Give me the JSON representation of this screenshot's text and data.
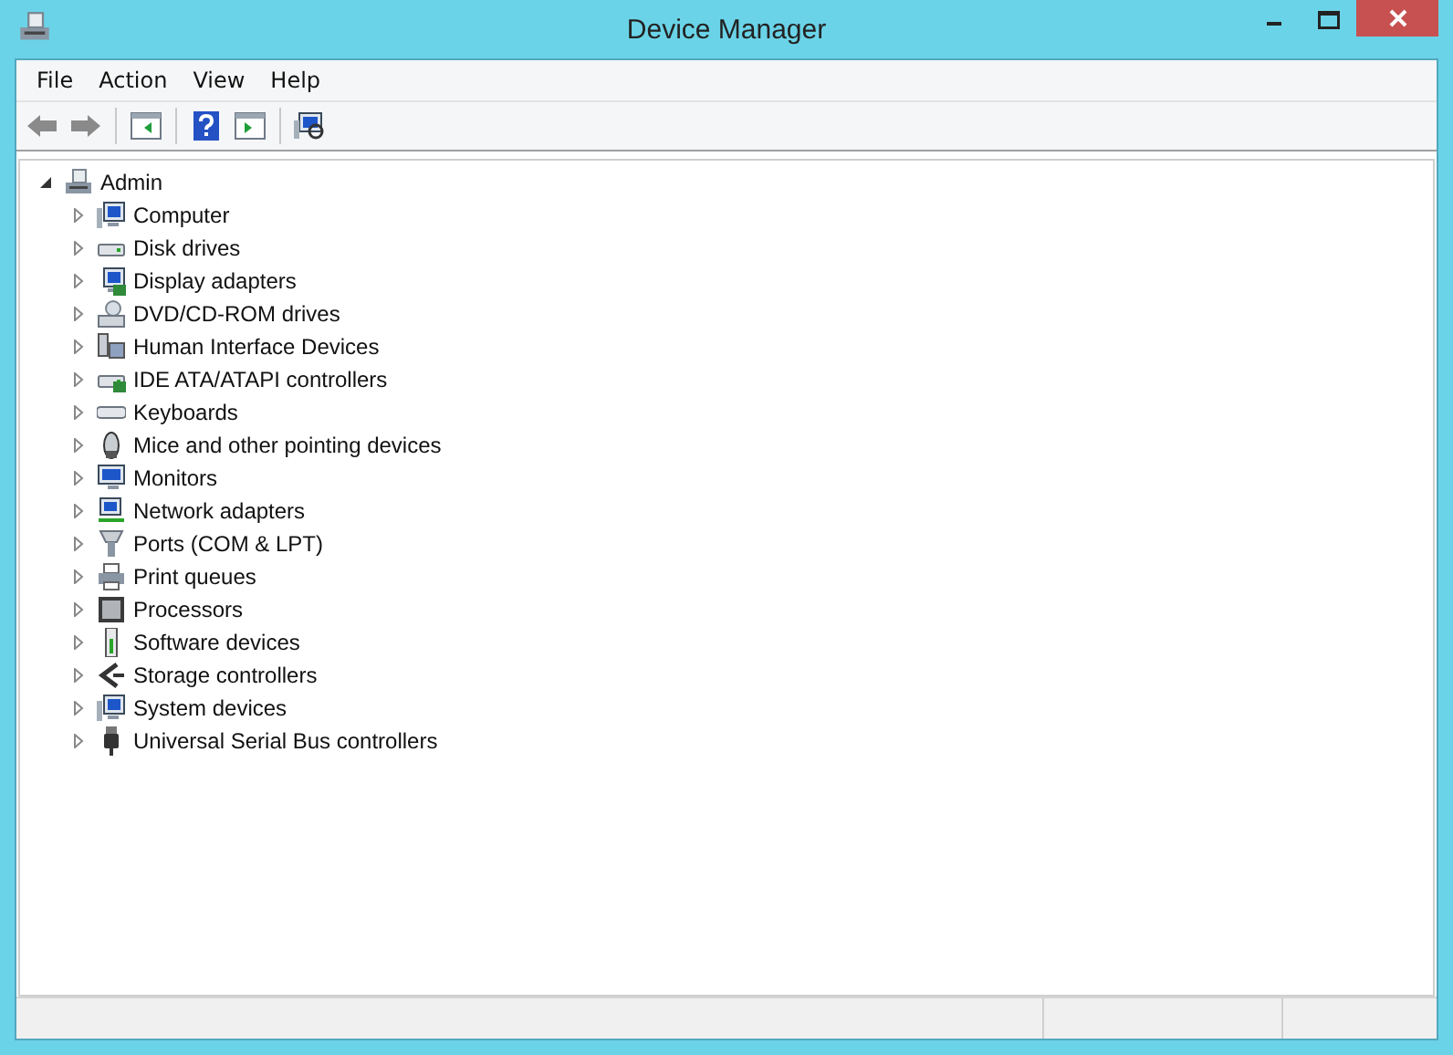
{
  "window": {
    "title": "Device Manager"
  },
  "menu": [
    "File",
    "Action",
    "View",
    "Help"
  ],
  "toolbar": [
    {
      "kind": "back",
      "disabled": true
    },
    {
      "kind": "forward",
      "disabled": true
    },
    {
      "kind": "sep"
    },
    {
      "kind": "hidepane",
      "disabled": false
    },
    {
      "kind": "sep"
    },
    {
      "kind": "help",
      "disabled": false
    },
    {
      "kind": "showpane",
      "disabled": false
    },
    {
      "kind": "sep"
    },
    {
      "kind": "scan",
      "disabled": false
    }
  ],
  "tree": {
    "label": "Admin",
    "kind": "host",
    "expanded": true,
    "children": [
      {
        "label": "Computer",
        "kind": "computer",
        "expanded": false
      },
      {
        "label": "Disk drives",
        "kind": "disk",
        "expanded": false
      },
      {
        "label": "Display adapters",
        "kind": "display",
        "expanded": false
      },
      {
        "label": "DVD/CD-ROM drives",
        "kind": "dvd",
        "expanded": false
      },
      {
        "label": "Human Interface Devices",
        "kind": "hid",
        "expanded": false
      },
      {
        "label": "IDE ATA/ATAPI controllers",
        "kind": "ide",
        "expanded": false
      },
      {
        "label": "Keyboards",
        "kind": "keyboard",
        "expanded": false
      },
      {
        "label": "Mice and other pointing devices",
        "kind": "mouse",
        "expanded": false
      },
      {
        "label": "Monitors",
        "kind": "monitor",
        "expanded": false
      },
      {
        "label": "Network adapters",
        "kind": "network",
        "expanded": false
      },
      {
        "label": "Ports (COM & LPT)",
        "kind": "port",
        "expanded": false
      },
      {
        "label": "Print queues",
        "kind": "printer",
        "expanded": false
      },
      {
        "label": "Processors",
        "kind": "cpu",
        "expanded": false
      },
      {
        "label": "Software devices",
        "kind": "software",
        "expanded": false
      },
      {
        "label": "Storage controllers",
        "kind": "storage",
        "expanded": false
      },
      {
        "label": "System devices",
        "kind": "system",
        "expanded": false
      },
      {
        "label": "Universal Serial Bus controllers",
        "kind": "usb",
        "expanded": false
      }
    ]
  }
}
